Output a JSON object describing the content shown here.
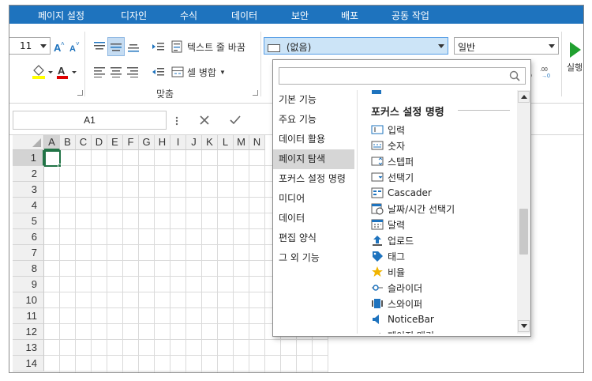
{
  "menu": {
    "tabs": [
      "페이지 설정",
      "디자인",
      "수식",
      "데이터",
      "보안",
      "배포",
      "공동 작업"
    ]
  },
  "ribbon": {
    "font_size": "11",
    "wrap_text_label": "텍스트 줄 바꿈",
    "merge_label": "셀 병합",
    "align_group_label": "맞춤",
    "style_combo_value": "(없음)",
    "number_format_value": "일반",
    "run_label": "실행",
    "colors": {
      "fill": "#ffff00",
      "font": "#e00000",
      "accent": "#1e73be",
      "run": "#21a030"
    }
  },
  "formula": {
    "name_box": "A1",
    "cancel_icon": "close-icon",
    "confirm_icon": "check-icon"
  },
  "grid": {
    "columns": [
      "A",
      "B",
      "C",
      "D",
      "E",
      "F",
      "G",
      "H",
      "I",
      "J",
      "K",
      "L",
      "M",
      "N"
    ],
    "rows": [
      "1",
      "2",
      "3",
      "4",
      "5",
      "6",
      "7",
      "8",
      "9",
      "10",
      "11",
      "12",
      "13",
      "14"
    ],
    "active_cell": "A1"
  },
  "dropdown": {
    "search_placeholder": "",
    "categories": [
      "기본 기능",
      "주요 기능",
      "데이터 활용",
      "페이지 탐색",
      "포커스 설정 명령",
      "미디어",
      "데이터",
      "편집 양식",
      "그 외 기능"
    ],
    "selected_category": "페이지 탐색",
    "section_title": "포커스 설정 명령",
    "commands": [
      "입력",
      "숫자",
      "스텝퍼",
      "선택기",
      "Cascader",
      "날짜/시간 선택기",
      "달력",
      "업로드",
      "태그",
      "비율",
      "슬라이더",
      "스와이퍼",
      "NoticeBar",
      "페이지 매기"
    ]
  }
}
